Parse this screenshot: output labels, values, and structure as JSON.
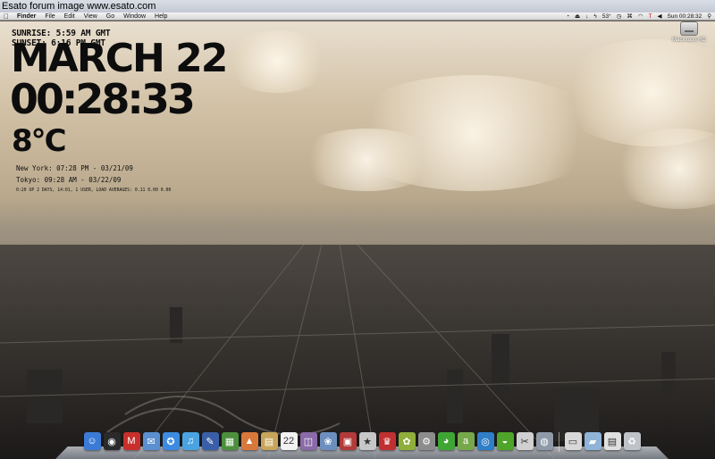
{
  "watermark": {
    "text": "Esato forum image www.esato.com"
  },
  "menubar": {
    "apple_icon": "apple-icon",
    "items": [
      "Finder",
      "File",
      "Edit",
      "View",
      "Go",
      "Window",
      "Help"
    ],
    "status": {
      "temp": "53°",
      "time": "Sun 00:28:32"
    }
  },
  "desktop": {
    "drive_label": "Macintosh HD"
  },
  "widgets": {
    "sunrise": "SUNRISE: 5:59 AM GMT",
    "sunset": "SUNSET: 6:16 PM GMT",
    "date": "MARCH 22",
    "time": "00:28:33",
    "temperature": "8°C",
    "new_york": "New York: 07:28 PM - 03/21/09",
    "tokyo": "Tokyo: 09:28 AM - 03/22/09",
    "uptime": "0:20 UP 2 DAYS, 14:01, 1 USER, LOAD AVERAGES: 0.11 0.00 0.00"
  },
  "dock": {
    "icons": [
      {
        "name": "finder-icon",
        "glyph": "☺",
        "color": "#3b7bd6"
      },
      {
        "name": "dashboard-icon",
        "glyph": "◉",
        "color": "#2a2a2a"
      },
      {
        "name": "gmail-icon",
        "glyph": "M",
        "color": "#c9302c"
      },
      {
        "name": "mail-icon",
        "glyph": "✉",
        "color": "#5b8fd0"
      },
      {
        "name": "safari-icon",
        "glyph": "✪",
        "color": "#3d8be0"
      },
      {
        "name": "itunes-icon",
        "glyph": "♫",
        "color": "#4aa3e0"
      },
      {
        "name": "xcode-icon",
        "glyph": "✎",
        "color": "#3a5fa8"
      },
      {
        "name": "photo-icon",
        "glyph": "▦",
        "color": "#4c8f3c"
      },
      {
        "name": "keynote-icon",
        "glyph": "▲",
        "color": "#d9783b"
      },
      {
        "name": "book-icon",
        "glyph": "▤",
        "color": "#c8a55a"
      },
      {
        "name": "ical-icon",
        "glyph": "22",
        "color": "#f2f2f2"
      },
      {
        "name": "preview-icon",
        "glyph": "◫",
        "color": "#8a6aa8"
      },
      {
        "name": "iphoto-icon",
        "glyph": "❀",
        "color": "#6c8fbf"
      },
      {
        "name": "app-store-icon",
        "glyph": "▣",
        "color": "#b23a3a"
      },
      {
        "name": "star-icon",
        "glyph": "★",
        "color": "#c7c7c7"
      },
      {
        "name": "chair-icon",
        "glyph": "♛",
        "color": "#c03030"
      },
      {
        "name": "fruit-icon",
        "glyph": "✿",
        "color": "#8fae3a"
      },
      {
        "name": "system-prefs-icon",
        "glyph": "⚙",
        "color": "#8c8c8c"
      },
      {
        "name": "chrome-icon",
        "glyph": "◕",
        "color": "#3fa535"
      },
      {
        "name": "amazon-icon",
        "glyph": "a",
        "color": "#76a84b"
      },
      {
        "name": "disc-icon",
        "glyph": "◎",
        "color": "#2e7ec9"
      },
      {
        "name": "spotify-icon",
        "glyph": "◒",
        "color": "#4ea52a"
      },
      {
        "name": "tools-icon",
        "glyph": "✂",
        "color": "#d0d0d0"
      },
      {
        "name": "bag-icon",
        "glyph": "◍",
        "color": "#8f9aa8"
      }
    ],
    "right_icons": [
      {
        "name": "monitor-icon",
        "glyph": "▭",
        "color": "#d8d8d8"
      },
      {
        "name": "folder-icon",
        "glyph": "▰",
        "color": "#8fb4d8"
      },
      {
        "name": "documents-icon",
        "glyph": "▤",
        "color": "#e0e0e0"
      },
      {
        "name": "trash-icon",
        "glyph": "♻",
        "color": "#bfc3c8"
      }
    ]
  }
}
